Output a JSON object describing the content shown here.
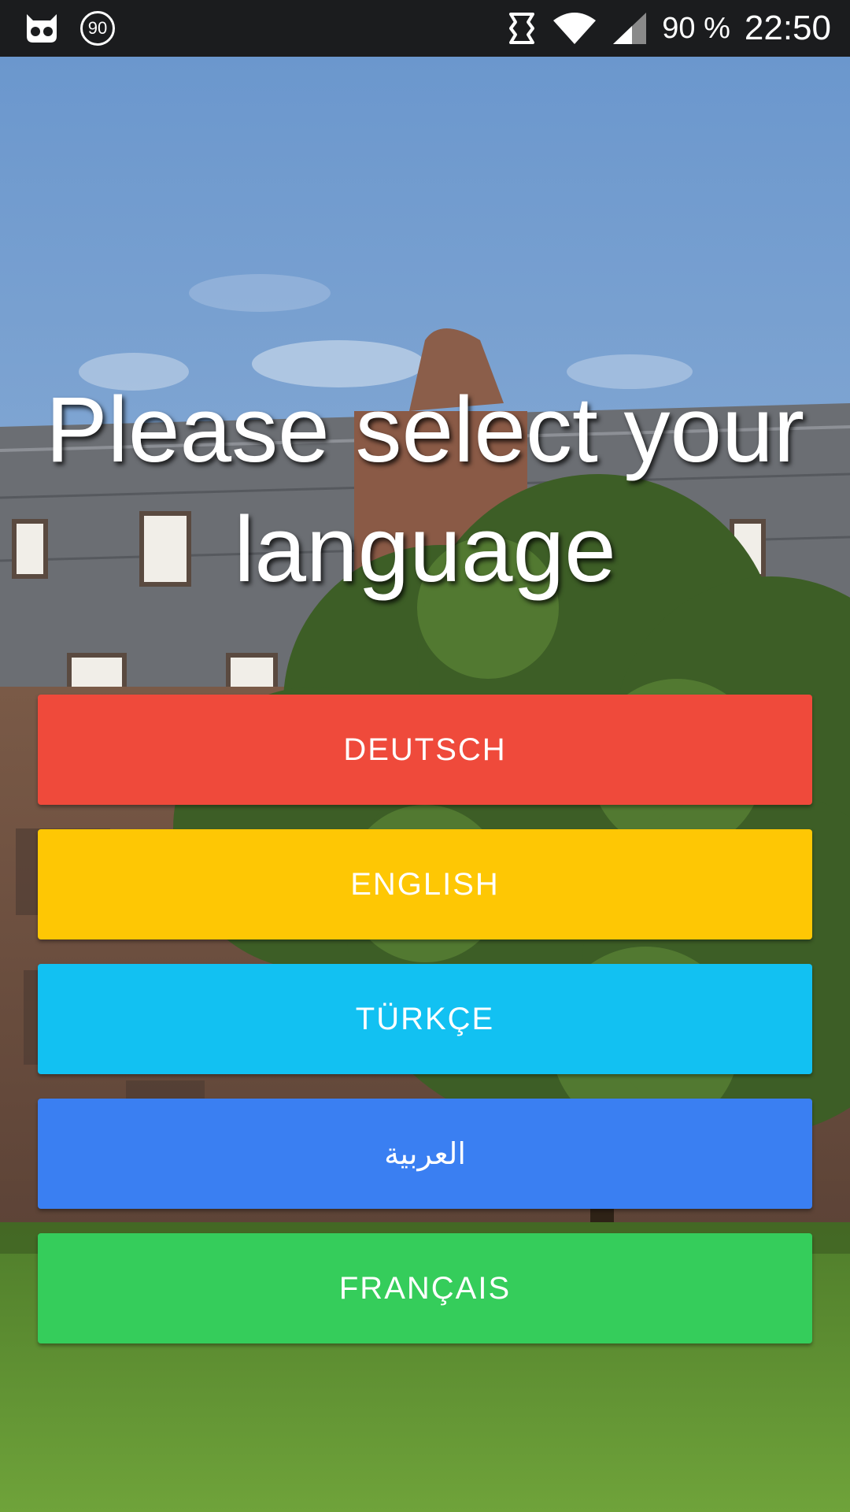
{
  "status_bar": {
    "left_icons": [
      "cyanogen-mascot-icon",
      "update-count-icon"
    ],
    "update_count": "90",
    "right_icons": [
      "nfc-icon",
      "wifi-icon",
      "cell-signal-icon"
    ],
    "battery": "90 %",
    "time": "22:50"
  },
  "main": {
    "heading": "Please select your language",
    "languages": [
      {
        "label": "DEUTSCH",
        "color": "#ef4a3b"
      },
      {
        "label": "ENGLISH",
        "color": "#fec704"
      },
      {
        "label": "TÜRKÇE",
        "color": "#12c1f2"
      },
      {
        "label": "العربية",
        "color": "#3a7ff2"
      },
      {
        "label": "FRANÇAIS",
        "color": "#35cd5b"
      }
    ]
  },
  "colors": {
    "status_bar": "#1b1c1e",
    "sky": "#6f97c9",
    "grass": "#5c8f2f",
    "text": "#ffffff"
  }
}
